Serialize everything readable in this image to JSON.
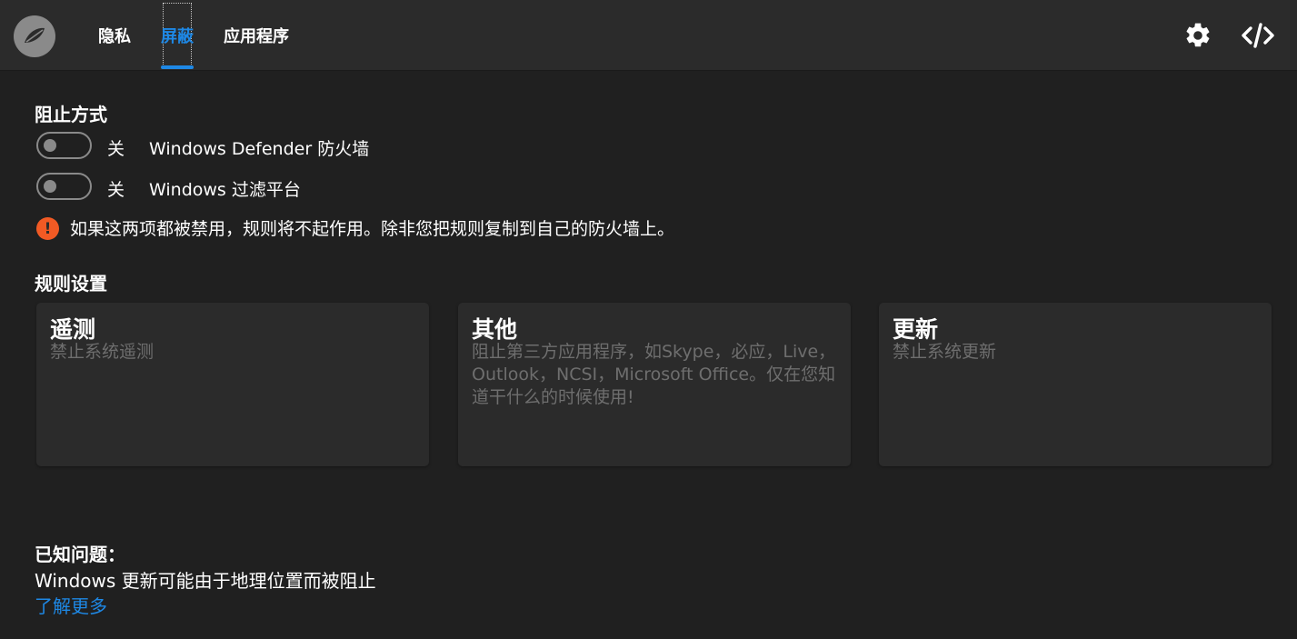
{
  "header": {
    "tabs": [
      {
        "label": "隐私",
        "active": false
      },
      {
        "label": "屏蔽",
        "active": true
      },
      {
        "label": "应用程序",
        "active": false
      }
    ],
    "icons": [
      "app-logo-icon",
      "gear-icon",
      "code-icon"
    ],
    "accent_color": "#1e88e5"
  },
  "blocking": {
    "title": "阻止方式",
    "options": [
      {
        "state": "关",
        "label": "Windows Defender 防火墙"
      },
      {
        "state": "关",
        "label": "Windows 过滤平台"
      }
    ],
    "warning": "如果这两项都被禁用，规则将不起作用。除非您把规则复制到自己的防火墙上。",
    "warning_color": "#f15a24"
  },
  "rules": {
    "title": "规则设置",
    "cards": [
      {
        "title": "遥测",
        "description": "禁止系统遥测"
      },
      {
        "title": "其他",
        "description": "阻止第三方应用程序，如Skype，必应，Live，Outlook，NCSI，Microsoft Office。仅在您知道干什么的时候使用!"
      },
      {
        "title": "更新",
        "description": "禁止系统更新"
      }
    ]
  },
  "known_issues": {
    "title": "已知问题：",
    "text": "Windows 更新可能由于地理位置而被阻止",
    "link": "了解更多"
  }
}
